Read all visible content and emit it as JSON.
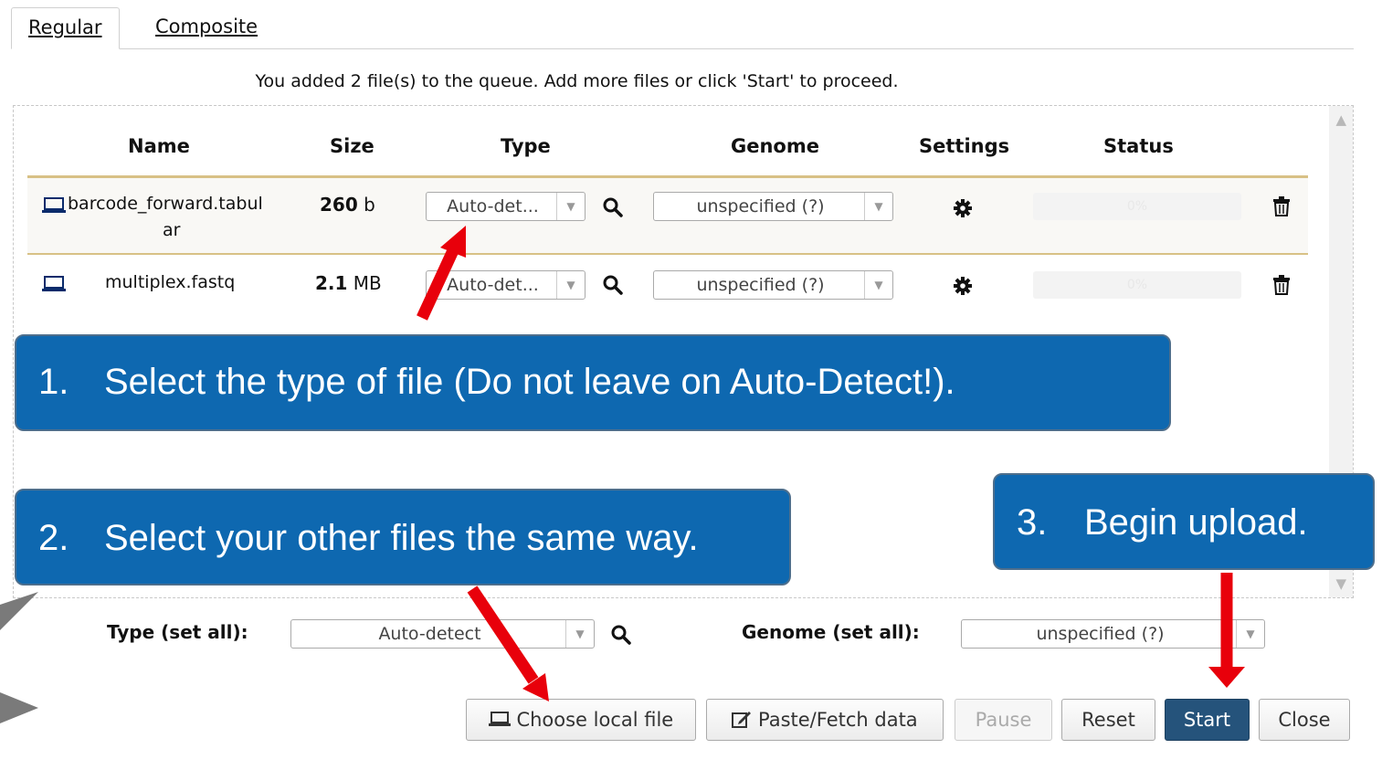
{
  "tabs": {
    "regular": "Regular",
    "composite": "Composite"
  },
  "queue_message": "You added 2 file(s) to the queue. Add more files or click 'Start' to proceed.",
  "columns": {
    "name": "Name",
    "size": "Size",
    "type": "Type",
    "genome": "Genome",
    "settings": "Settings",
    "status": "Status"
  },
  "files": [
    {
      "name_line1": "barcode_forward.tabul",
      "name_line2": "ar",
      "size_num": "260",
      "size_unit": "b",
      "type": "Auto-det...",
      "genome": "unspecified (?)",
      "progress": "0%"
    },
    {
      "name": "multiplex.fastq",
      "size_num": "2.1",
      "size_unit": "MB",
      "type": "Auto-det...",
      "genome": "unspecified (?)",
      "progress": "0%"
    }
  ],
  "set_all": {
    "type_label": "Type (set all):",
    "type_value": "Auto-detect",
    "genome_label": "Genome (set all):",
    "genome_value": "unspecified (?)"
  },
  "buttons": {
    "choose": "Choose local file",
    "paste": "Paste/Fetch data",
    "pause": "Pause",
    "reset": "Reset",
    "start": "Start",
    "close": "Close"
  },
  "callouts": [
    {
      "num": "1.",
      "text": "Select the type of file (Do not leave on Auto-Detect!)."
    },
    {
      "num": "2.",
      "text": "Select your other files the same way."
    },
    {
      "num": "3.",
      "text": "Begin upload."
    }
  ],
  "colors": {
    "callout_bg": "#0e68b0",
    "arrow": "#e8000b",
    "start_bg": "#25537b",
    "row_divider": "#d8c186"
  },
  "icons": {
    "file": "laptop-icon",
    "search": "search-icon",
    "settings": "gear-icon",
    "delete": "trash-icon",
    "edit": "edit-icon"
  }
}
